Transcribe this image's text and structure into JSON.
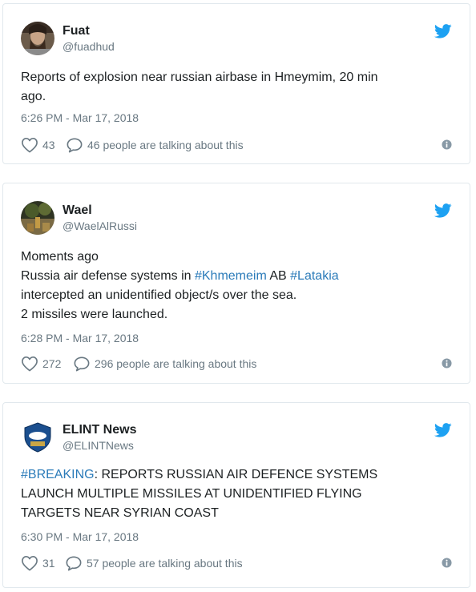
{
  "tweets": [
    {
      "display_name": "Fuat",
      "handle": "@fuadhud",
      "avatar_icon": "bearded-man-avatar",
      "text_lines": [
        [
          {
            "t": "Reports of explosion near russian airbase in Hmeymim, 20 min",
            "tag": false
          }
        ],
        [
          {
            "t": "ago.",
            "tag": false
          }
        ]
      ],
      "timestamp": "6:26 PM - Mar 17, 2018",
      "likes": "43",
      "talking": "46 people are talking about this"
    },
    {
      "display_name": "Wael",
      "handle": "@WaelAlRussi",
      "avatar_icon": "landscape-avatar",
      "text_lines": [
        [
          {
            "t": "Moments ago",
            "tag": false
          }
        ],
        [
          {
            "t": "Russia air defense systems in ",
            "tag": false
          },
          {
            "t": "#Khmemeim",
            "tag": true
          },
          {
            "t": " AB ",
            "tag": false
          },
          {
            "t": "#Latakia",
            "tag": true
          }
        ],
        [
          {
            "t": "intercepted an unidentified object/s over the sea.",
            "tag": false
          }
        ],
        [
          {
            "t": "2 missiles were launched.",
            "tag": false
          }
        ]
      ],
      "timestamp": "6:28 PM - Mar 17, 2018",
      "likes": "272",
      "talking": "296 people are talking about this"
    },
    {
      "display_name": "ELINT News",
      "handle": "@ELINTNews",
      "avatar_icon": "elint-news-logo",
      "text_lines": [
        [
          {
            "t": "#BREAKING",
            "tag": true
          },
          {
            "t": ": REPORTS RUSSIAN AIR DEFENCE SYSTEMS",
            "tag": false
          }
        ],
        [
          {
            "t": "LAUNCH MULTIPLE MISSILES AT UNIDENTIFIED FLYING",
            "tag": false
          }
        ],
        [
          {
            "t": "TARGETS NEAR SYRIAN COAST",
            "tag": false
          }
        ]
      ],
      "timestamp": "6:30 PM - Mar 17, 2018",
      "likes": "31",
      "talking": "57 people are talking about this"
    }
  ],
  "icons": {
    "brand": "twitter-bird-icon",
    "like": "heart-icon",
    "reply": "speech-bubble-icon",
    "info": "info-icon"
  },
  "colors": {
    "twitter_blue": "#1da1f2",
    "hashtag": "#2b7bb9",
    "meta_gray": "#697882",
    "border": "#e1e8ed"
  }
}
